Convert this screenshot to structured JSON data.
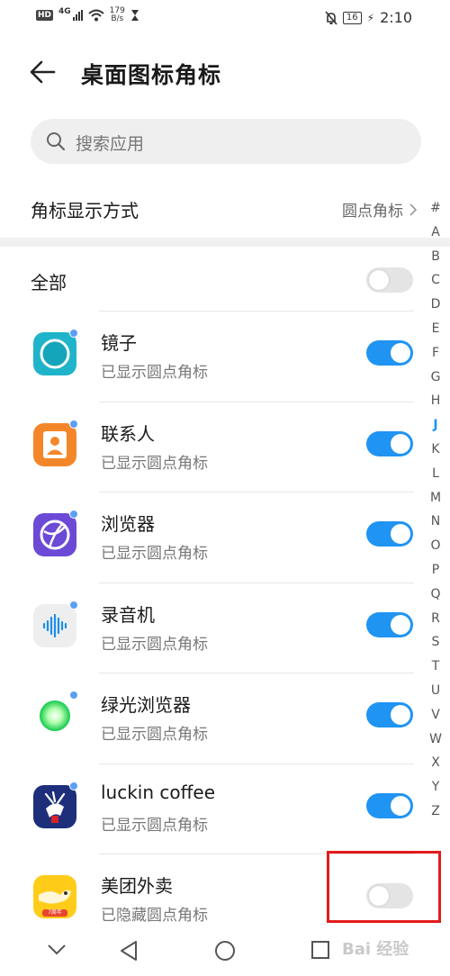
{
  "status_bar": {
    "hd": "HD",
    "network": "4G",
    "speed_value": "179",
    "speed_unit": "B/s",
    "battery": "16",
    "time": "2:10"
  },
  "header": {
    "title": "桌面图标角标"
  },
  "search": {
    "placeholder": "搜索应用"
  },
  "badge_setting": {
    "label": "角标显示方式",
    "value": "圆点角标"
  },
  "all_row": {
    "label": "全部",
    "enabled": false
  },
  "apps": [
    {
      "name": "镜子",
      "status": "已显示圆点角标",
      "enabled": true,
      "icon": "mirror-icon",
      "color": "#1fb4c9"
    },
    {
      "name": "联系人",
      "status": "已显示圆点角标",
      "enabled": true,
      "icon": "contacts-icon",
      "color": "#f4862a"
    },
    {
      "name": "浏览器",
      "status": "已显示圆点角标",
      "enabled": true,
      "icon": "browser-icon",
      "color": "#6c4ad6"
    },
    {
      "name": "录音机",
      "status": "已显示圆点角标",
      "enabled": true,
      "icon": "recorder-icon",
      "color": "#eeeeee"
    },
    {
      "name": "绿光浏览器",
      "status": "已显示圆点角标",
      "enabled": true,
      "icon": "green-browser-icon",
      "color": "#2fd56a"
    },
    {
      "name": "luckin coffee",
      "status": "已显示圆点角标",
      "enabled": true,
      "icon": "luckin-coffee-icon",
      "color": "#1d2f7a"
    },
    {
      "name": "美团外卖",
      "status": "已隐藏圆点角标",
      "enabled": false,
      "icon": "meituan-waimai-icon",
      "color": "#ffcc1a",
      "tag": "7周年"
    }
  ],
  "index_letters": [
    "#",
    "A",
    "B",
    "C",
    "D",
    "E",
    "F",
    "G",
    "H",
    "J",
    "K",
    "L",
    "M",
    "N",
    "O",
    "P",
    "Q",
    "R",
    "S",
    "T",
    "U",
    "V",
    "W",
    "X",
    "Y",
    "Z"
  ],
  "active_letter": "J",
  "watermark": "Bai 经验",
  "colors": {
    "accent": "#2094f3",
    "highlight_box": "#e21b1b"
  }
}
